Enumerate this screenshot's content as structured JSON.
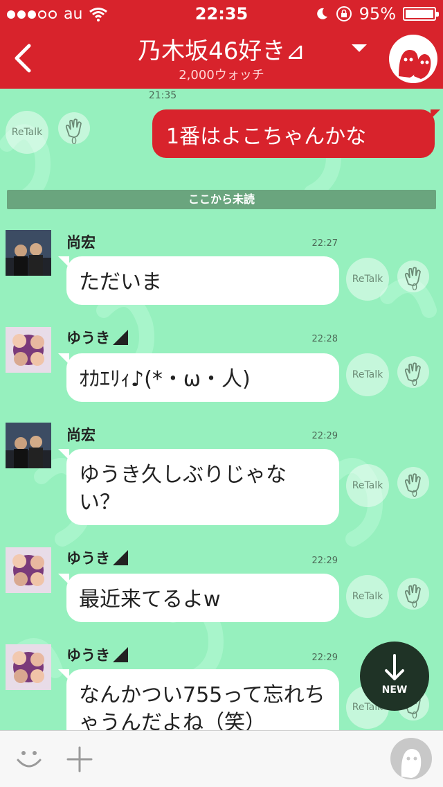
{
  "status_bar": {
    "carrier": "au",
    "time": "22:35",
    "battery": "95%",
    "signal_icon": "signal-dots-icon",
    "wifi_icon": "wifi-icon",
    "moon_icon": "moon-icon",
    "lock_icon": "rotation-lock-icon",
    "battery_level": 0.95
  },
  "header": {
    "title": "乃木坂46好き⊿",
    "subtitle": "2,000ウォッチ",
    "back_icon": "chevron-left-icon",
    "dropdown_icon": "caret-down-icon",
    "accent": "#d8232c"
  },
  "chat": {
    "background": "#96f0be",
    "top_timestamp": "21:35",
    "outgoing": {
      "text": "1番はよこちゃんかな",
      "retalk": "ReTalk",
      "clap_count": "0"
    },
    "unread_divider": "ここから未読",
    "messages": [
      {
        "sender": "尚宏",
        "time": "22:27",
        "text": "ただいま",
        "retalk": "ReTalk",
        "clap_count": "0"
      },
      {
        "sender": "ゆうき",
        "time": "22:28",
        "text": "ｵｶｴﾘｨ♪(*・ω・人)",
        "retalk": "ReTalk",
        "clap_count": "0"
      },
      {
        "sender": "尚宏",
        "time": "22:29",
        "text": "ゆうき久しぶりじゃない？",
        "retalk": "ReTalk",
        "clap_count": "0"
      },
      {
        "sender": "ゆうき",
        "time": "22:29",
        "text": "最近来てるよw",
        "retalk": "ReTalk",
        "clap_count": "0"
      },
      {
        "sender": "ゆうき",
        "time": "22:29",
        "text": "なんかつい755って忘れちゃうんだよね（笑）",
        "retalk": "ReTalk",
        "clap_count": "0"
      }
    ]
  },
  "new_button": {
    "label": "NEW",
    "icon": "arrow-down-icon"
  },
  "bottom_bar": {
    "emoji_icon": "smiley-icon",
    "add_icon": "plus-icon",
    "avatar_icon": "user-avatar-icon"
  }
}
